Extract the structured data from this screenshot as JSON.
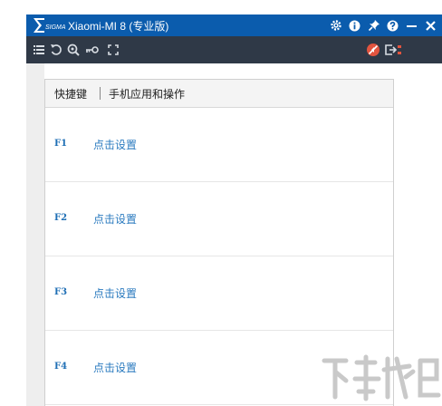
{
  "window": {
    "app_title": "Xiaomi-MI 8 (专业版)",
    "logo_text": "SIGMA",
    "colors": {
      "titlebar": "#0b5cad",
      "toolbar": "#2f3947",
      "link": "#2a7abf"
    }
  },
  "title_controls": [
    "gear-icon",
    "info-icon",
    "pin-icon",
    "help-icon",
    "minimize-icon",
    "close-icon"
  ],
  "toolbar_tools": [
    "list-icon",
    "refresh-icon",
    "zoom-icon",
    "key-icon",
    "fullscreen-icon",
    "no-sound-icon",
    "exit-icon"
  ],
  "tabs": [
    {
      "label": "快捷键"
    },
    {
      "label": "手机应用和操作"
    }
  ],
  "shortcuts": [
    {
      "key": "F1",
      "action": "点击设置"
    },
    {
      "key": "F2",
      "action": "点击设置"
    },
    {
      "key": "F3",
      "action": "点击设置"
    },
    {
      "key": "F4",
      "action": "点击设置"
    }
  ]
}
